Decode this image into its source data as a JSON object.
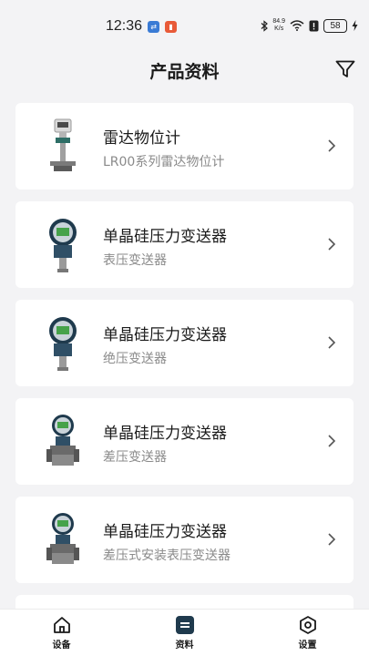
{
  "status_bar": {
    "time": "12:36",
    "net_speed_value": "84.9",
    "net_speed_unit": "K/s",
    "battery": "58"
  },
  "header": {
    "title": "产品资料",
    "filter_icon": "filter-icon"
  },
  "products": [
    {
      "title": "雷达物位计",
      "subtitle": "LR00系列雷达物位计",
      "image": "radar-level-gauge"
    },
    {
      "title": "单晶硅压力变送器",
      "subtitle": "表压变送器",
      "image": "pressure-transmitter"
    },
    {
      "title": "单晶硅压力变送器",
      "subtitle": "绝压变送器",
      "image": "pressure-transmitter"
    },
    {
      "title": "单晶硅压力变送器",
      "subtitle": "差压变送器",
      "image": "diff-pressure-transmitter"
    },
    {
      "title": "单晶硅压力变送器",
      "subtitle": "差压式安装表压变送器",
      "image": "diff-pressure-transmitter"
    }
  ],
  "bottom_nav": [
    {
      "label": "设备",
      "icon": "home-icon",
      "active": false
    },
    {
      "label": "资料",
      "icon": "document-icon",
      "active": true
    },
    {
      "label": "设置",
      "icon": "settings-icon",
      "active": false
    }
  ],
  "colors": {
    "background": "#f3f3f5",
    "card": "#ffffff",
    "accent": "#1f3a4d",
    "subtitle": "#8a8a8a"
  }
}
